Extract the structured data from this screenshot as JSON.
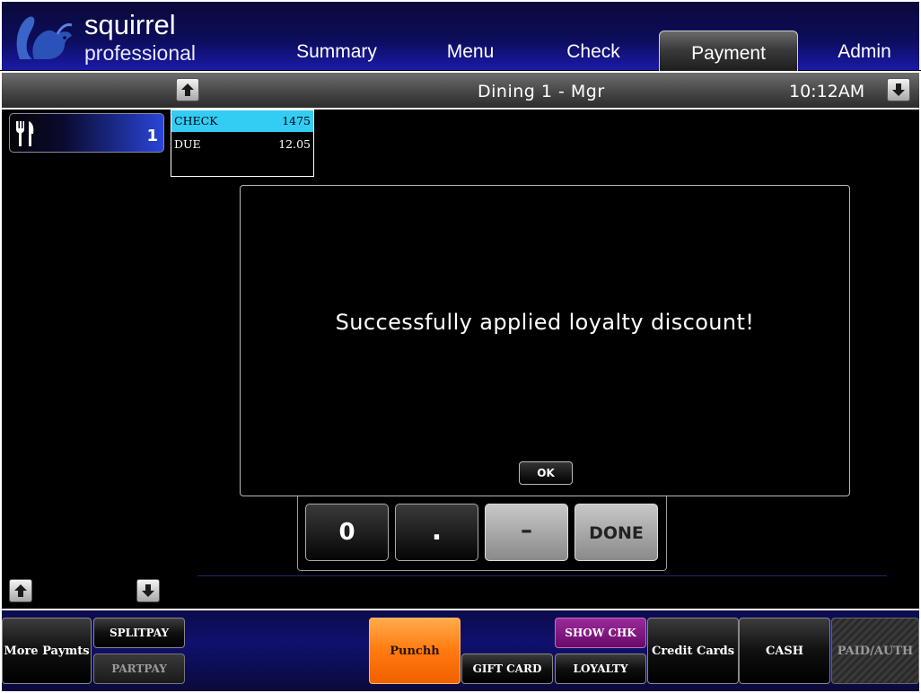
{
  "header": {
    "logo_line1": "squirrel",
    "logo_line2": "professional",
    "tabs": [
      {
        "label": "Summary"
      },
      {
        "label": "Menu"
      },
      {
        "label": "Check"
      },
      {
        "label": "Payment",
        "active": true
      },
      {
        "label": "Admin"
      }
    ]
  },
  "subheader": {
    "title": "Dining 1 - Mgr",
    "time": "10:12AM"
  },
  "table": {
    "icon": "fork-knife-icon",
    "number": "1"
  },
  "check": {
    "row1_label": "CHECK",
    "row1_value": "1475",
    "row2_label": "DUE",
    "row2_value": "12.05"
  },
  "dialog": {
    "message": "Successfully applied loyalty discount!",
    "ok_label": "OK"
  },
  "keypad": {
    "keys": [
      "0",
      ".",
      "–",
      "DONE"
    ]
  },
  "footer": {
    "more_payments": "More Paymts",
    "splitpay": "SPLITPAY",
    "partpay": "PARTPAY",
    "punchh": "Punchh",
    "gift_card": "GIFT CARD",
    "show_chk": "SHOW CHK",
    "loyalty": "LOYALTY",
    "credit_cards": "Credit Cards",
    "cash": "CASH",
    "paid_auth": "PAID/AUTH"
  },
  "colors": {
    "check_highlight": "#33ccf2",
    "punchh_orange": "#ff7a10",
    "show_chk_purple": "#6a0a6a",
    "header_blue": "#0c0c5a"
  }
}
